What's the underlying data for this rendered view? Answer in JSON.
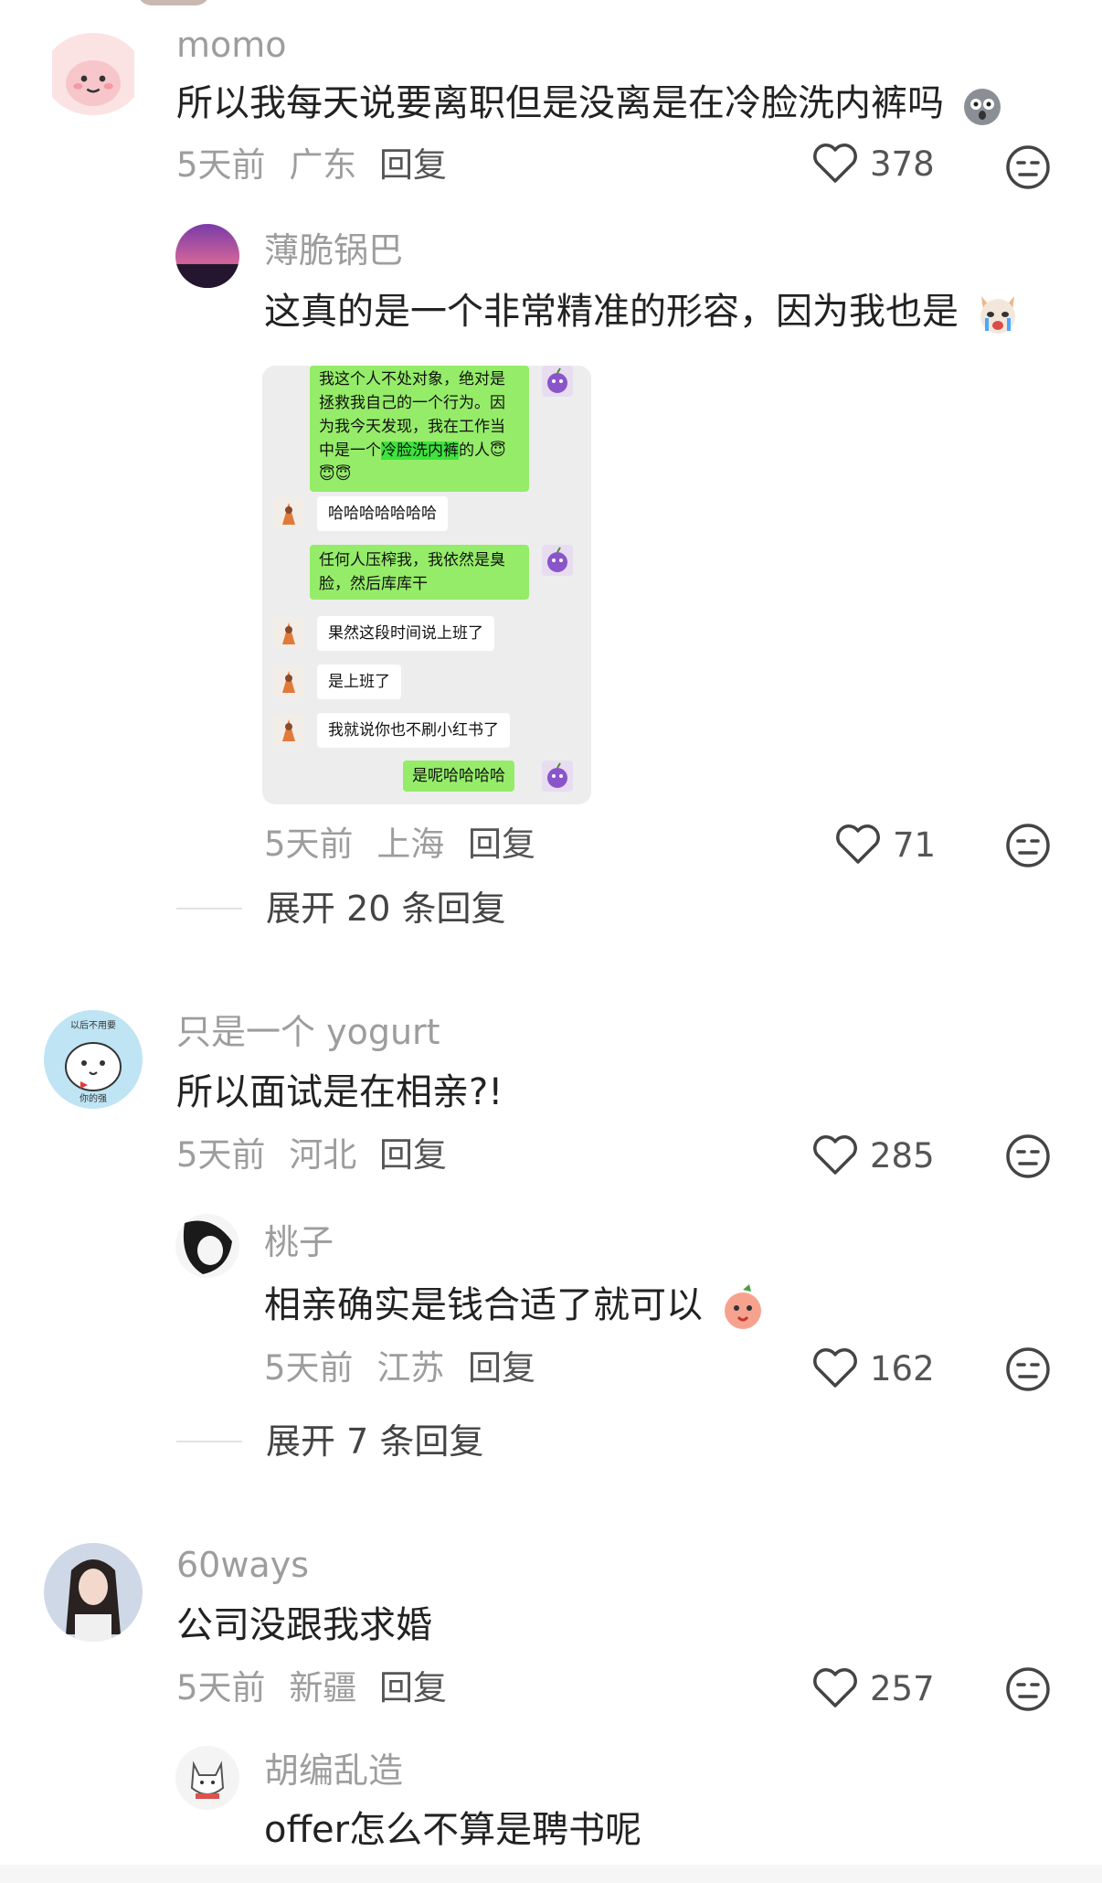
{
  "comments": [
    {
      "user": "momo",
      "text": "所以我每天说要离职但是没离是在冷脸洗内裤吗",
      "time": "5天前",
      "location": "广东",
      "reply_label": "回复",
      "likes": "378",
      "replies": [
        {
          "user": "薄脆锅巴",
          "text": "这真的是一个非常精准的形容，因为我也是",
          "time": "5天前",
          "location": "上海",
          "reply_label": "回复",
          "likes": "71"
        }
      ],
      "expand_label": "展开 20 条回复"
    },
    {
      "user": "只是一个 yogurt",
      "avatar_caption": "以后不用要",
      "avatar_caption2": "你的强",
      "text": "所以面试是在相亲?!",
      "time": "5天前",
      "location": "河北",
      "reply_label": "回复",
      "likes": "285",
      "replies": [
        {
          "user": "桃子",
          "text": "相亲确实是钱合适了就可以",
          "time": "5天前",
          "location": "江苏",
          "reply_label": "回复",
          "likes": "162"
        }
      ],
      "expand_label": "展开 7 条回复"
    },
    {
      "user": "60ways",
      "text": "公司没跟我求婚",
      "time": "5天前",
      "location": "新疆",
      "reply_label": "回复",
      "likes": "257",
      "replies": [
        {
          "user": "胡编乱造",
          "text": "offer怎么不算是聘书呢"
        }
      ]
    }
  ],
  "chat_image": {
    "messages": [
      {
        "side": "right",
        "text_before": "我这个人不处对象，绝对是拯救我自己的一个行为。因为我今天发现，我在工作当中是一个",
        "highlight": "冷脸洗内裤",
        "text_after": "的人😇😇😇"
      },
      {
        "side": "left",
        "text": "哈哈哈哈哈哈哈"
      },
      {
        "side": "right",
        "text": "任何人压榨我，我依然是臭脸，然后库库干"
      },
      {
        "side": "left",
        "text": "果然这段时间说上班了"
      },
      {
        "side": "left",
        "text": "是上班了"
      },
      {
        "side": "left",
        "text": "我就说你也不刷小红书了"
      },
      {
        "side": "right",
        "text": "是呢哈哈哈哈"
      }
    ]
  },
  "colors": {
    "muted_text": "#9d9d9d",
    "body_text": "#222222",
    "chat_green": "#95ec69",
    "chat_bg": "#ededed"
  },
  "icons": [
    "heart-icon",
    "dislike-face-icon"
  ]
}
